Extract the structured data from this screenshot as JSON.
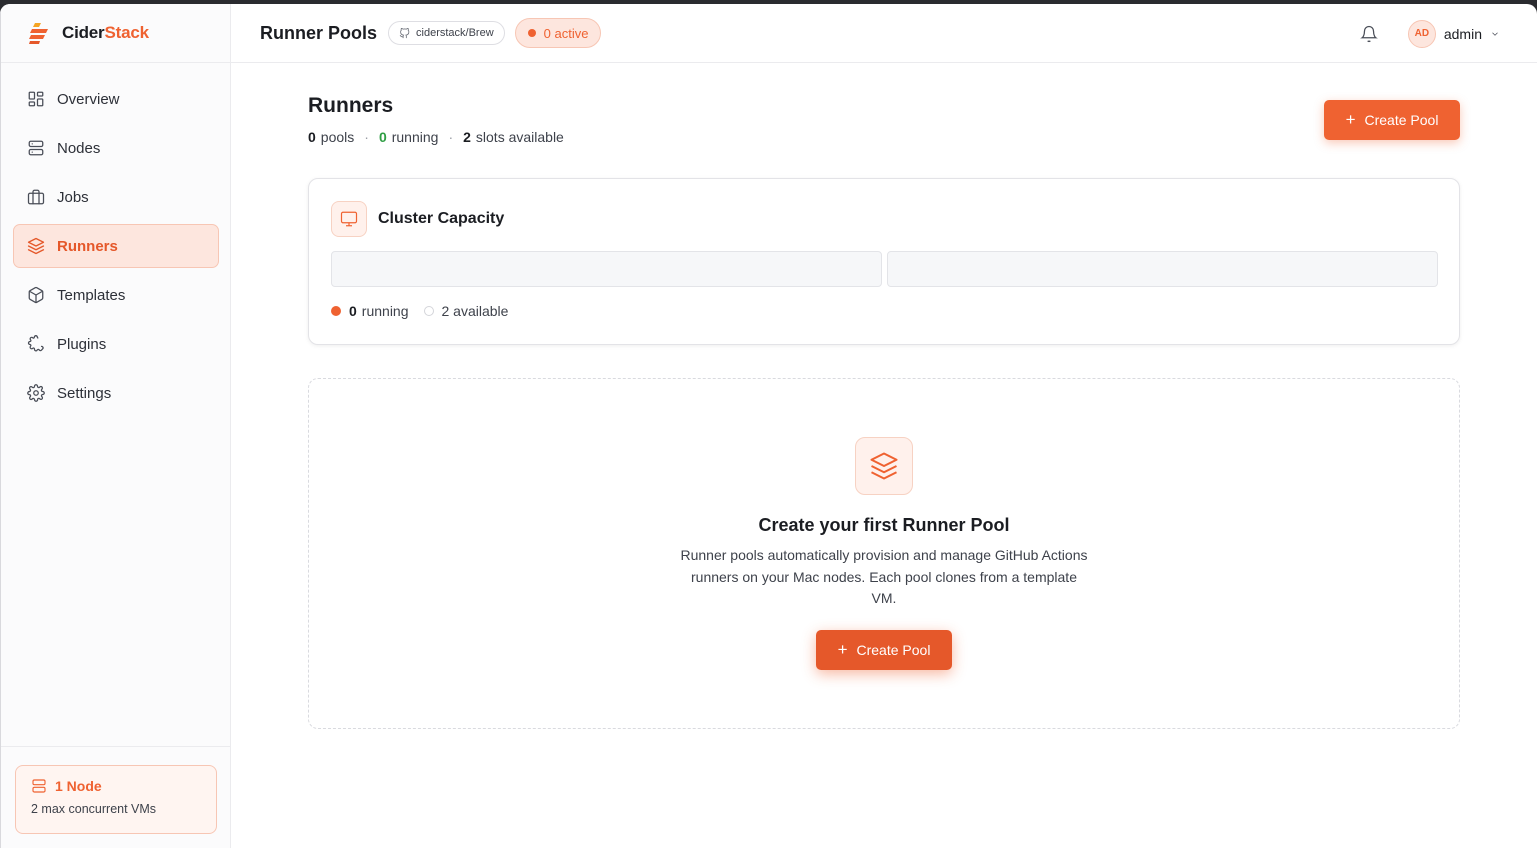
{
  "brand": {
    "name_part1": "Cider",
    "name_part2": "Stack"
  },
  "sidebar": {
    "items": [
      {
        "label": "Overview",
        "icon": "grid-icon"
      },
      {
        "label": "Nodes",
        "icon": "server-icon"
      },
      {
        "label": "Jobs",
        "icon": "briefcase-icon"
      },
      {
        "label": "Runners",
        "icon": "layers-icon",
        "active": true
      },
      {
        "label": "Templates",
        "icon": "cube-icon"
      },
      {
        "label": "Plugins",
        "icon": "puzzle-icon"
      },
      {
        "label": "Settings",
        "icon": "gear-icon"
      }
    ],
    "footer": {
      "title": "1 Node",
      "subtitle": "2 max concurrent VMs"
    }
  },
  "header": {
    "title": "Runner Pools",
    "repo": "ciderstack/Brew",
    "active_badge": "0 active",
    "user": {
      "initials": "AD",
      "name": "admin"
    }
  },
  "main": {
    "title": "Runners",
    "stats": {
      "pools_count": "0",
      "pools_label": "pools",
      "running_count": "0",
      "running_label": "running",
      "slots_count": "2",
      "slots_label": "slots available",
      "separator": "·"
    },
    "create_button": "Create Pool",
    "capacity": {
      "title": "Cluster Capacity",
      "running_count": "0",
      "running_label": "running",
      "available_label": "2 available"
    },
    "empty_state": {
      "title": "Create your first Runner Pool",
      "description": "Runner pools automatically provision and manage GitHub Actions runners on your Mac nodes. Each pool clones from a template VM.",
      "button": "Create Pool"
    }
  },
  "colors": {
    "accent": "#ef6231",
    "accent_light": "#fde6de",
    "success": "#2f9e44"
  }
}
